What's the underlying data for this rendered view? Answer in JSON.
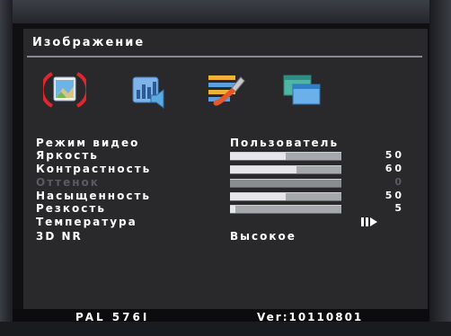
{
  "osd": {
    "title": "Изображение",
    "tabs": [
      {
        "icon": "picture-icon",
        "selected": true
      },
      {
        "icon": "sound-chart-icon",
        "selected": false
      },
      {
        "icon": "tools-icon",
        "selected": false
      },
      {
        "icon": "windows-icon",
        "selected": false
      }
    ],
    "settings": [
      {
        "label": "Режим видео",
        "kind": "text",
        "value": "Пользователь",
        "disabled": false
      },
      {
        "label": "Яркость",
        "kind": "slider",
        "level": 50,
        "value": "50",
        "disabled": false
      },
      {
        "label": "Контрастность",
        "kind": "slider",
        "level": 60,
        "value": "60",
        "disabled": false
      },
      {
        "label": "Оттенок",
        "kind": "slider",
        "level": 0,
        "value": "0",
        "disabled": true
      },
      {
        "label": "Насыщенность",
        "kind": "slider",
        "level": 50,
        "value": "50",
        "disabled": false
      },
      {
        "label": "Резкость",
        "kind": "slider",
        "level": 5,
        "value": "5",
        "disabled": false
      },
      {
        "label": "Температура",
        "kind": "arrow",
        "value": "",
        "disabled": false
      },
      {
        "label": "3D NR",
        "kind": "text",
        "value": "Высокое",
        "disabled": false
      }
    ],
    "footer": {
      "signal": "PAL  576I",
      "version": "Ver:10110801"
    }
  },
  "colors": {
    "osd_background": "#29292c",
    "text": "#ffffff",
    "disabled_text": "#5a5a60",
    "selection_ring": "#e0262e"
  }
}
